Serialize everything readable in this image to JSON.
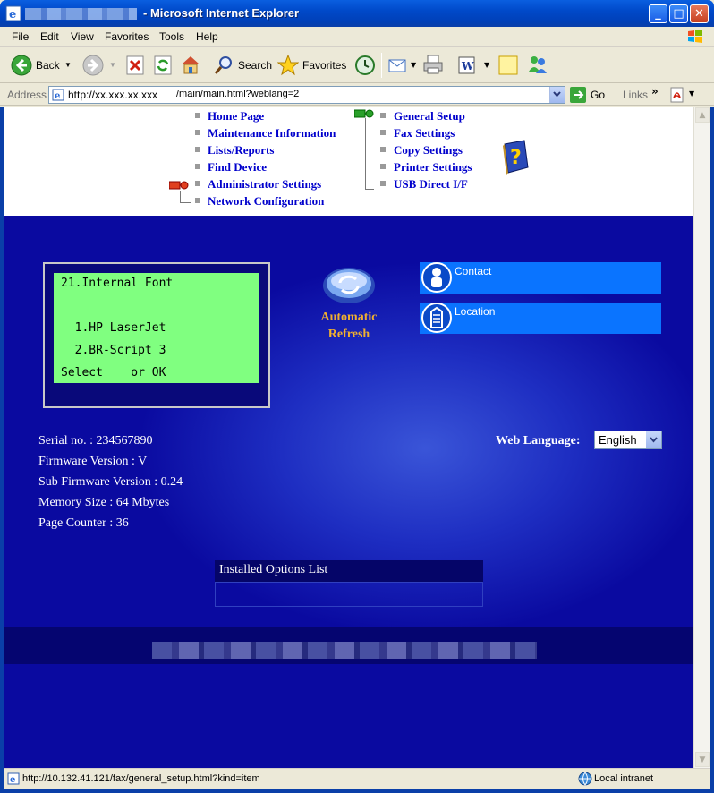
{
  "window": {
    "title": "- Microsoft Internet Explorer",
    "buttons": {
      "minimize": "_",
      "maximize": "□",
      "close": "✕"
    }
  },
  "menu": [
    "File",
    "Edit",
    "View",
    "Favorites",
    "Tools",
    "Help"
  ],
  "toolbar": {
    "back": "Back",
    "search": "Search",
    "favorites": "Favorites"
  },
  "address": {
    "label": "Address",
    "url_host": "http://xx.xxx.xx.xxx",
    "url_path": "/main/main.html?weblang=2",
    "go": "Go",
    "links": "Links",
    "chevron": "»"
  },
  "nav": {
    "left": [
      "Home Page",
      "Maintenance Information",
      "Lists/Reports",
      "Find Device",
      "Administrator Settings",
      "Network Configuration"
    ],
    "right": [
      "General Setup",
      "Fax Settings",
      "Copy Settings",
      "Printer Settings",
      "USB Direct I/F"
    ]
  },
  "lcd": {
    "line1": "21.Internal Font",
    "line2": "  1.HP LaserJet",
    "line3": "  2.BR-Script 3",
    "line4": "Select    or OK"
  },
  "refresh": {
    "line1": "Automatic",
    "line2": "Refresh"
  },
  "links_panel": {
    "contact": "Contact",
    "location": "Location"
  },
  "device_info": {
    "serial": "Serial no. : 234567890",
    "firmware": "Firmware Version : V",
    "sub_firmware": "Sub Firmware Version : 0.24",
    "memory": "Memory Size : 64 Mbytes",
    "page_counter": "Page Counter : 36"
  },
  "web_language": {
    "label": "Web Language:",
    "selected": "English"
  },
  "options": {
    "title": "Installed Options List"
  },
  "status": {
    "url": "http://10.132.41.121/fax/general_setup.html?kind=item",
    "zone": "Local intranet"
  }
}
